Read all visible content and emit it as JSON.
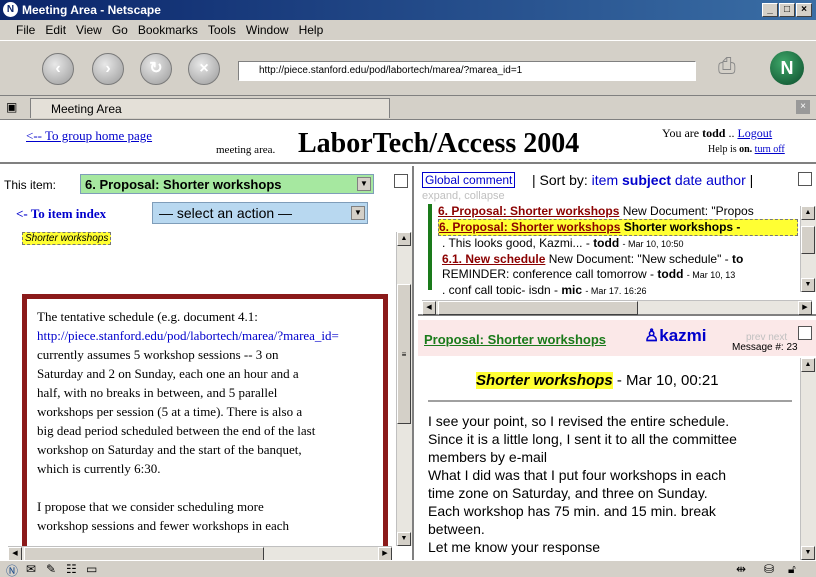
{
  "window": {
    "title": "Meeting Area - Netscape"
  },
  "menu": [
    "File",
    "Edit",
    "View",
    "Go",
    "Bookmarks",
    "Tools",
    "Window",
    "Help"
  ],
  "nav": {
    "url": "http://piece.stanford.edu/pod/labortech/marea/?marea_id=1"
  },
  "tab": {
    "label": "Meeting Area"
  },
  "header": {
    "home_link": "<-- To group home page",
    "meeting_area": "meeting area.",
    "title": "LaborTech/Access 2004",
    "you_are": "You are",
    "user": "todd",
    "logout": "Logout",
    "help_prefix": "Help is",
    "help_state": "on.",
    "help_link": "turn off"
  },
  "left": {
    "this_item_label": "This item:",
    "item_select": "6. Proposal: Shorter workshops",
    "to_index": "<- To item index",
    "action_select": "— select an action —",
    "highlight_tag": "Shorter workshops",
    "body_lines": [
      "The tentative schedule (e.g. document 4.1:",
      "http://piece.stanford.edu/pod/labortech/marea/?marea_id=",
      "currently assumes 5 workshop sessions -- 3 on",
      "Saturday and 2 on Sunday, each one an hour and a",
      "half, with no breaks in between, and 5 parallel",
      "workshops per session (5 at a time). There is also a",
      "big dead period scheduled between the end of the last",
      "workshop on Saturday and the start of the banquet,",
      "which is currently 6:30.",
      "",
      "I propose that we consider scheduling more",
      "workshop sessions and fewer workshops in each"
    ]
  },
  "rtop": {
    "global_comment": "Global comment",
    "sort_by": "Sort by:",
    "sort_item": "item",
    "sort_subject": "subject",
    "sort_date": "date",
    "sort_author": "author",
    "expand": "expand, collapse",
    "threads": [
      {
        "title": "6. Proposal: Shorter workshops",
        "text": "New Document: \"Propos"
      },
      {
        "title": "6. Proposal: Shorter workshops",
        "text": "Shorter workshops -"
      },
      {
        "text": ". This looks good, Kazmi... -",
        "author": "todd",
        "date": "- Mar 10, 10:50"
      },
      {
        "title": "6.1. New schedule",
        "text": "New Document: \"New schedule\" -",
        "author": "to"
      },
      {
        "text": "REMINDER: conference call tomorrow -",
        "author": "todd",
        "date": "- Mar 10, 13"
      },
      {
        "text": ". conf call topic- isdn -",
        "author": "mic",
        "date": "- Mar 17, 16:26"
      }
    ]
  },
  "rbot": {
    "subject": "Proposal: Shorter workshops",
    "author": "kazmi",
    "prevnext": "prev next",
    "message_label": "Message #: 23",
    "headline": "Shorter workshops",
    "date": "- Mar 10, 00:21",
    "body_lines": [
      "I see your point, so I revised the entire schedule.",
      "Since it is a little long, I sent it to all the committee",
      "members by e-mail",
      "What I did was that I put four workshops in each",
      "time zone on Saturday, and three on Sunday.",
      "Each workshop has 75 min. and 15 min. break",
      "between.",
      "Let me know your response"
    ]
  },
  "colors": {
    "titlebar": "#0a246a",
    "item_select_bg": "#a6e8a0",
    "action_select_bg": "#b8d8f0",
    "highlight": "#ffff33",
    "link": "#0000cc",
    "thread_title": "#8b0000",
    "frame_border": "#8b1a1a"
  }
}
